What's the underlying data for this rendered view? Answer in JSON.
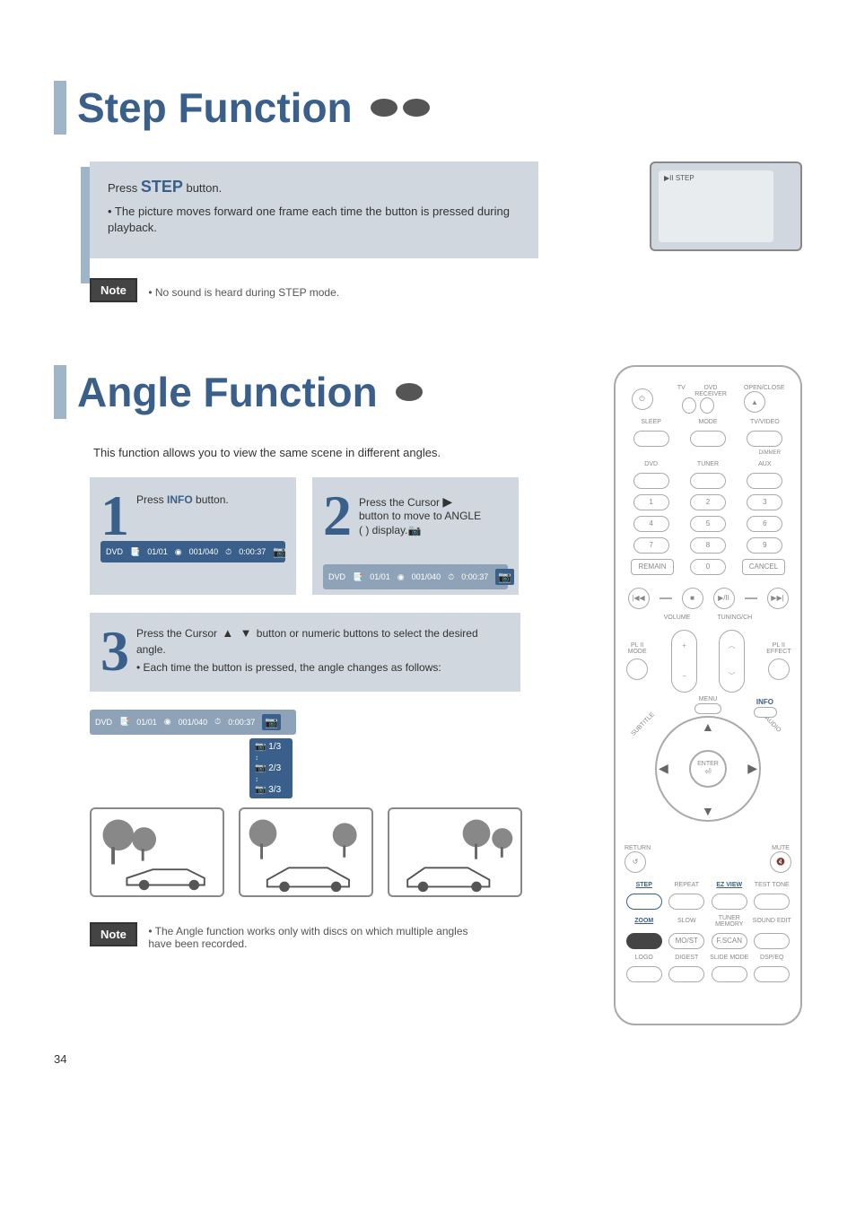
{
  "page_number": "34",
  "section1": {
    "title": "Step Function",
    "dot_count": 2,
    "step_label": "STEP",
    "step_text_prefix": "Press ",
    "step_text_suffix": " button.",
    "step_bullet": "• The picture moves forward one frame each time the button is pressed during playback.",
    "tv_osd": "▶II STEP",
    "note_label": "Note",
    "note_text": "• No sound is heard during STEP mode."
  },
  "section2": {
    "title": "Angle Function",
    "dot_count": 1,
    "intro": "This function allows you to view the same scene in different angles.",
    "step1": {
      "num": "1",
      "prefix": "Press ",
      "label": "INFO",
      "suffix": " button."
    },
    "step2": {
      "num": "2",
      "line1_prefix": "Press the Cursor ",
      "line1_suffix": "  button to move to ANGLE",
      "line2": " (      ) display."
    },
    "step3": {
      "num": "3",
      "line1_prefix": "Press the Cursor   ",
      "line1_suffix": "  button or numeric buttons to select the desired angle."
    },
    "osd": {
      "disc": "DVD",
      "title": "01/01",
      "chapter": "001/040",
      "time": "0:00:37"
    },
    "angle_values": [
      "1/3",
      "2/3",
      "3/3"
    ],
    "note_label": "Note",
    "note_text": "• The Angle function works only with discs on which multiple angles have been recorded."
  },
  "remote": {
    "top": {
      "power": "⏻",
      "tv": "TV",
      "dvd": "DVD RECEIVER",
      "openclose": "OPEN/CLOSE",
      "eject": "▲"
    },
    "row_labels": {
      "sleep": "SLEEP",
      "mode": "MODE",
      "tvvideo": "TV/VIDEO",
      "dimmer": "DIMMER",
      "dvd": "DVD",
      "tuner": "TUNER",
      "aux": "AUX"
    },
    "numbers": [
      "1",
      "2",
      "3",
      "4",
      "5",
      "6",
      "7",
      "8",
      "9",
      "0"
    ],
    "remain": "REMAIN",
    "cancel": "CANCEL",
    "transport": {
      "prev": "|◀◀",
      "stop": "■",
      "play": "▶/II",
      "next": "▶▶|"
    },
    "vol_label": "VOLUME",
    "tune_label": "TUNING/CH",
    "pl2_mode": "PL II\nMODE",
    "pl2_effect": "PL II\nEFFECT",
    "menu": "MENU",
    "info": "INFO",
    "subtitle": "SUBTITLE",
    "audio": "AUDIO",
    "enter": "ENTER",
    "return": "RETURN",
    "mute": "MUTE",
    "bottom": {
      "step": "STEP",
      "repeat": "REPEAT",
      "ezview": "EZ VIEW",
      "testtone": "TEST TONE",
      "zoom": "ZOOM",
      "slow": "SLOW",
      "mo_st": "MO/ST",
      "tunermem": "TUNER MEMORY",
      "fscan": "F.SCAN",
      "soundedit": "SOUND EDIT",
      "logo": "LOGO",
      "digest": "DIGEST",
      "slidemode": "SLIDE MODE",
      "dsp_eq": "DSP/EQ"
    }
  }
}
